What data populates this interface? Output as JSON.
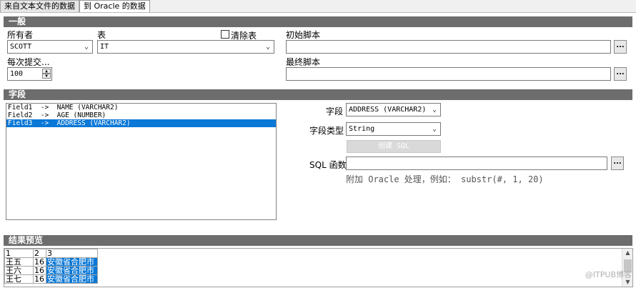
{
  "tabs": [
    "来自文本文件的数据",
    "到 Oracle 的数据"
  ],
  "general": {
    "title": "一般",
    "owner_label": "所有者",
    "owner_value": "SCOTT",
    "table_label": "表",
    "table_value": "IT",
    "clear_table_label": "清除表",
    "commit_label": "每次提交...",
    "commit_value": "100",
    "initial_script_label": "初始脚本",
    "final_script_label": "最终脚本",
    "dots": "..."
  },
  "fields": {
    "title": "字段",
    "items": [
      "Field1  ->  NAME (VARCHAR2)",
      "Field2  ->  AGE (NUMBER)",
      "Field3  ->  ADDRESS (VARCHAR2)"
    ],
    "field_label": "字段",
    "field_value": "ADDRESS (VARCHAR2)",
    "type_label": "字段类型",
    "type_value": "String",
    "create_sql_label": "创建 SQL",
    "sql_func_label": "SQL 函数",
    "hint": "附加 Oracle 处理，例如： substr(#, 1, 20)"
  },
  "preview": {
    "title": "结果预览",
    "headers": [
      "1",
      "2",
      "3"
    ],
    "rows": [
      [
        "王五",
        "16",
        "安徽省合肥市"
      ],
      [
        "王六",
        "16",
        "安徽省合肥市"
      ],
      [
        "王七",
        "16",
        "安徽省合肥市"
      ]
    ]
  },
  "watermark": "@ITPUB博客"
}
